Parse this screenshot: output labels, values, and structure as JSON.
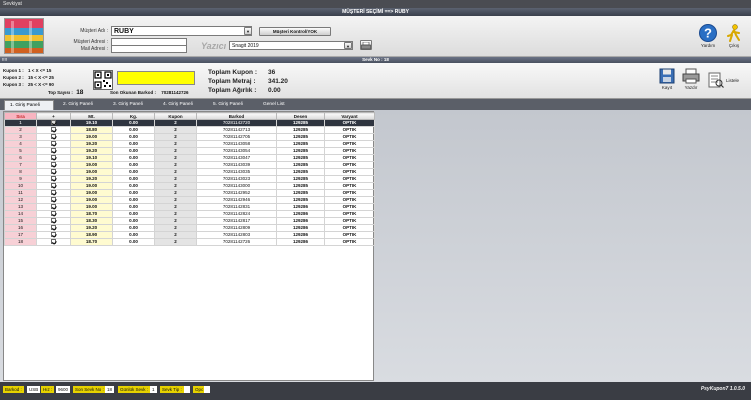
{
  "window": {
    "title": "Sevkiyat"
  },
  "customer_header": {
    "label": "MÜŞTERİ SEÇİMİ",
    "arrow": "==>",
    "name": "RUBY"
  },
  "customer_form": {
    "name_label": "Müşteri Adı :",
    "name_value": "RUBY",
    "address_label": "Müşteri Adresi :",
    "address_value": "",
    "mail_label": "Mail Adresi :",
    "mail_value": "",
    "control_button": "Müşteri Kontrol/YOK",
    "printer_label": "Yazıcı :",
    "printer_value": "Snagit 2019"
  },
  "top_actions": [
    {
      "label": "Yardım",
      "icon": "help-icon",
      "color": "#2a6fc4"
    },
    {
      "label": "Çıkış",
      "icon": "exit-icon",
      "color": "#f2c200"
    }
  ],
  "sevk_band": {
    "left": "!!!!",
    "text": "Sevk No : 18"
  },
  "kupon_rules": [
    {
      "label": "Kupon 1 :",
      "rule": "1 < X <= 15"
    },
    {
      "label": "Kupon 2 :",
      "rule": "15 < X <= 25"
    },
    {
      "label": "Kupon 3 :",
      "rule": "25 < X <= 90"
    }
  ],
  "top_sayisi": {
    "label": "Top Sayısı :",
    "value": "18"
  },
  "barcode": {
    "last_label": "Son Okunan Barkod :",
    "last_value": "70281142726",
    "input_color": "#ffff00"
  },
  "totals": [
    {
      "label": "Toplam Kupon :",
      "value": "36"
    },
    {
      "label": "Toplam Metraj :",
      "value": "341.20"
    },
    {
      "label": "Toplam Ağırlık :",
      "value": "0.00"
    }
  ],
  "right_actions": [
    {
      "label": "Kayıt",
      "icon": "save-icon"
    },
    {
      "label": "Yazdır",
      "icon": "printer-icon"
    },
    {
      "label": "Listele",
      "icon": "list-icon"
    }
  ],
  "tabs": [
    "1. Giriş Paneli",
    "2. Giriş Paneli",
    "3. Giriş Paneli",
    "4. Giriş Paneli",
    "5. Giriş Paneli",
    "Genel List"
  ],
  "grid": {
    "columns": [
      "Sıra",
      "+",
      "Mt.",
      "Kg.",
      "Kupon",
      "Barkod",
      "Desen",
      "Varyant"
    ],
    "rows": [
      [
        "1",
        "19.10",
        "0.00",
        "2",
        "70281142720",
        "129285",
        "OPTIK"
      ],
      [
        "2",
        "18.80",
        "0.00",
        "2",
        "70281142713",
        "129285",
        "OPTIK"
      ],
      [
        "3",
        "19.00",
        "0.00",
        "2",
        "70281142705",
        "129285",
        "OPTIK"
      ],
      [
        "4",
        "19.20",
        "0.00",
        "2",
        "70281143058",
        "129285",
        "OPTIK"
      ],
      [
        "5",
        "19.20",
        "0.00",
        "2",
        "70281143054",
        "129285",
        "OPTIK"
      ],
      [
        "6",
        "19.10",
        "0.00",
        "2",
        "70281143047",
        "129285",
        "OPTIK"
      ],
      [
        "7",
        "19.00",
        "0.00",
        "2",
        "70281143039",
        "129285",
        "OPTIK"
      ],
      [
        "8",
        "19.00",
        "0.00",
        "2",
        "70281143035",
        "129285",
        "OPTIK"
      ],
      [
        "9",
        "19.20",
        "0.00",
        "2",
        "70281143023",
        "129285",
        "OPTIK"
      ],
      [
        "10",
        "19.00",
        "0.00",
        "2",
        "70281143000",
        "129285",
        "OPTIK"
      ],
      [
        "11",
        "19.00",
        "0.00",
        "2",
        "70281142952",
        "129285",
        "OPTIK"
      ],
      [
        "12",
        "19.00",
        "0.00",
        "2",
        "70281142946",
        "129285",
        "OPTIK"
      ],
      [
        "13",
        "19.00",
        "0.00",
        "2",
        "70281142831",
        "129286",
        "OPTIK"
      ],
      [
        "14",
        "18.70",
        "0.00",
        "2",
        "70281142824",
        "129286",
        "OPTIK"
      ],
      [
        "15",
        "18.30",
        "0.00",
        "2",
        "70281142817",
        "129286",
        "OPTIK"
      ],
      [
        "16",
        "19.20",
        "0.00",
        "2",
        "70281142809",
        "129286",
        "OPTIK"
      ],
      [
        "17",
        "18.90",
        "0.00",
        "2",
        "70281142803",
        "129286",
        "OPTIK"
      ],
      [
        "18",
        "18.70",
        "0.00",
        "2",
        "70281142726",
        "129286",
        "OPTIK"
      ]
    ]
  },
  "status_bar": [
    {
      "label": "Barkod :",
      "value": "USB"
    },
    {
      "label": "Hız :",
      "value": "9600"
    },
    {
      "label": "Son Sevk No :",
      "value": "18"
    },
    {
      "label": "Günlük Sevk :",
      "value": "1"
    },
    {
      "label": "Sevk Tip :",
      "value": ""
    },
    {
      "label": "Opc",
      "value": ""
    }
  ],
  "version": "PsyKupon7 1.0.5.0"
}
